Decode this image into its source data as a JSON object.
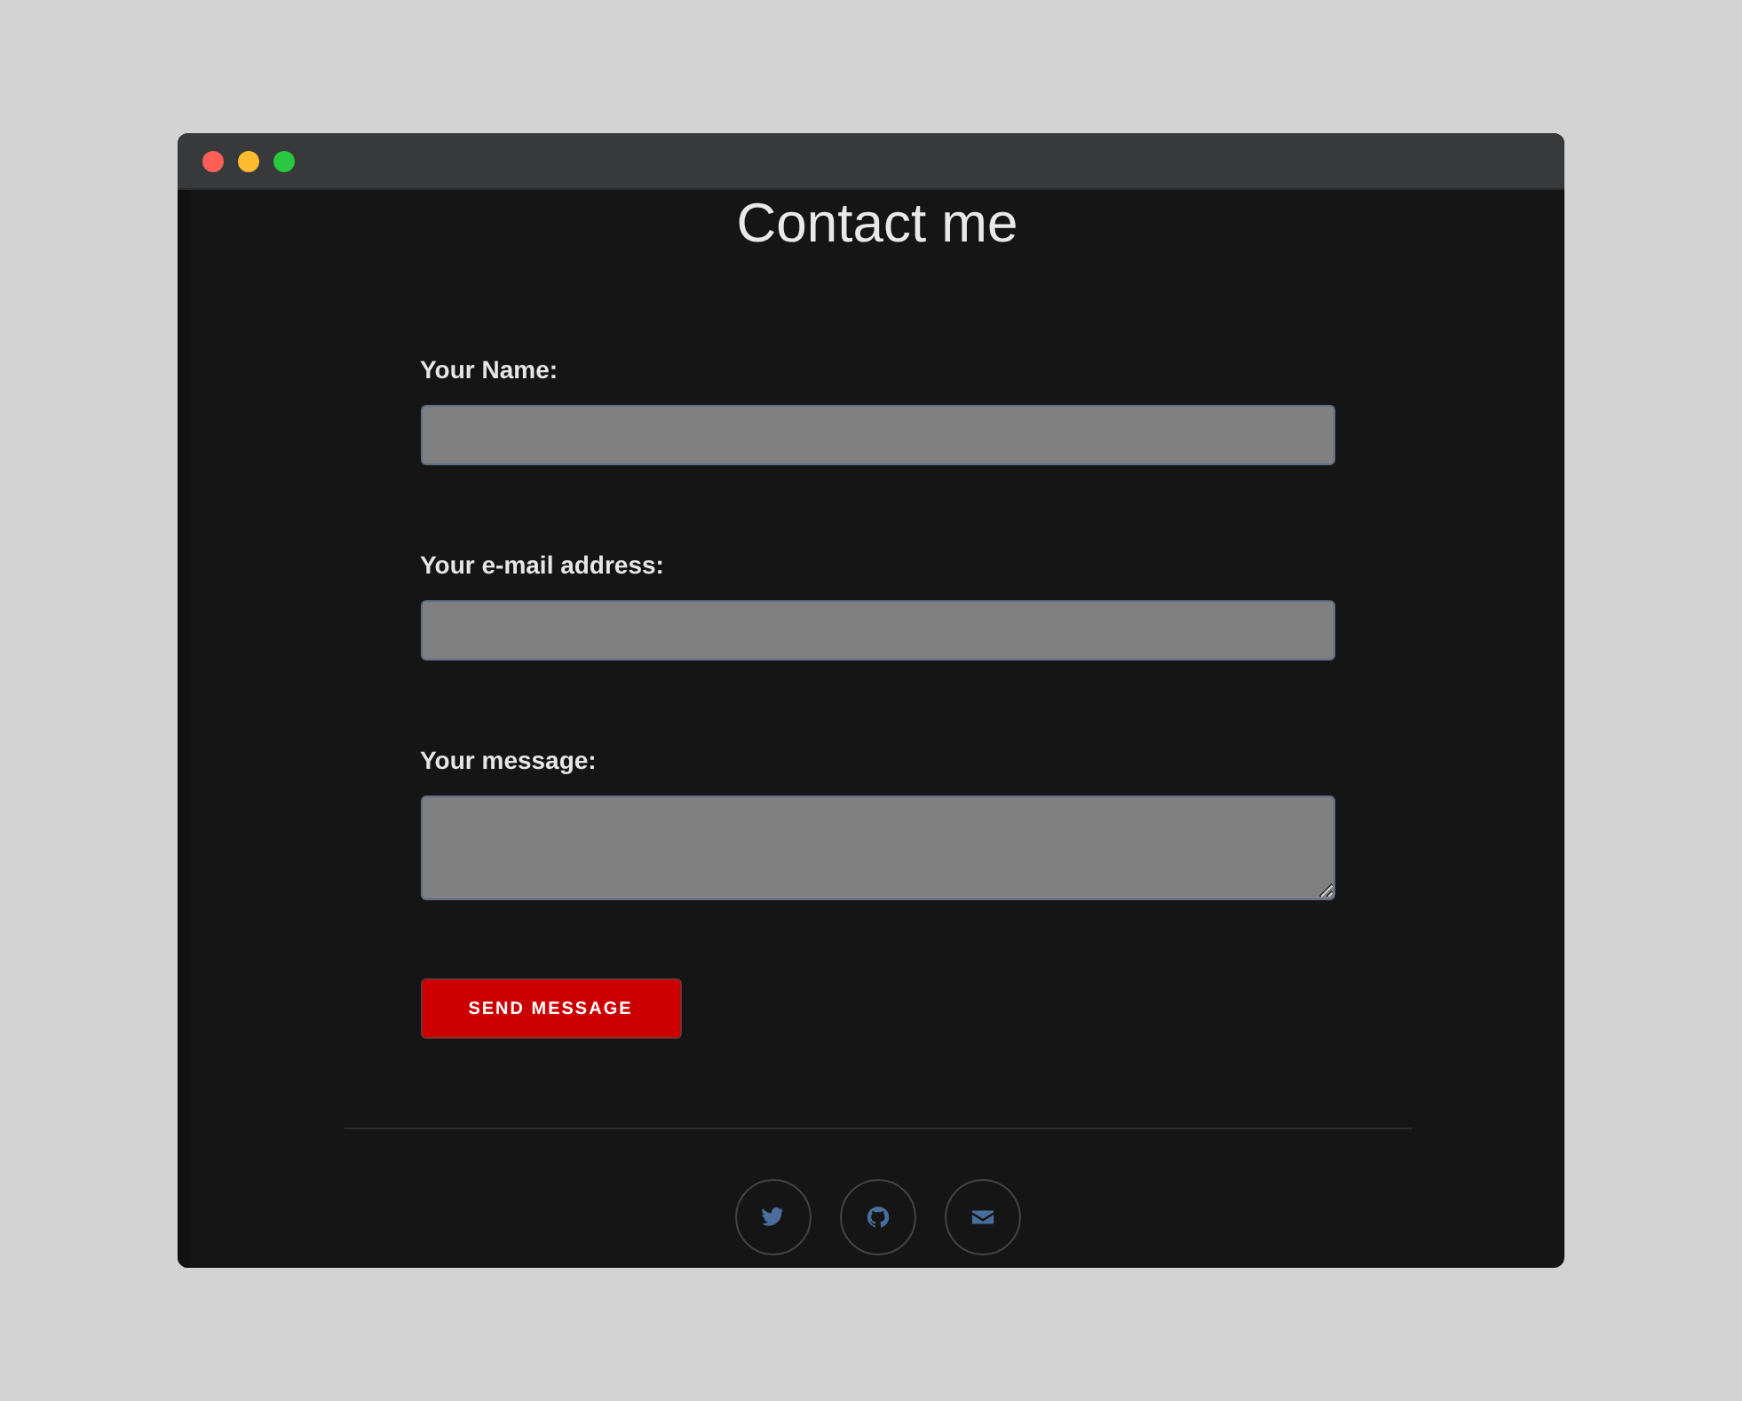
{
  "heading": "Contact me",
  "fields": [
    {
      "label": "Your Name:",
      "kind": "input"
    },
    {
      "label": "Your e-mail address:",
      "kind": "input"
    },
    {
      "label": "Your message:",
      "kind": "textarea"
    }
  ],
  "submit": "SEND MESSAGE",
  "social_links": [
    {
      "kind": "bird"
    },
    {
      "kind": "octocat"
    },
    {
      "kind": "envelope"
    }
  ]
}
